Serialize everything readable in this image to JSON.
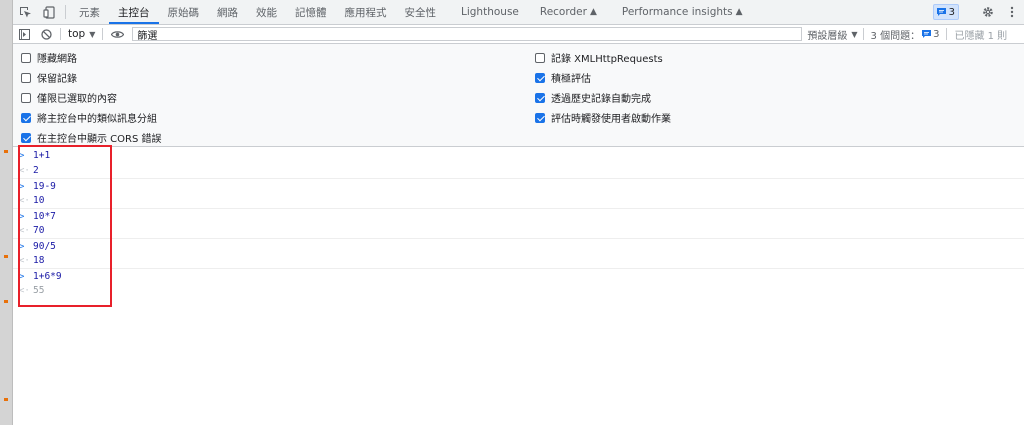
{
  "tabs": {
    "items": [
      {
        "label": "元素"
      },
      {
        "label": "主控台"
      },
      {
        "label": "原始碼"
      },
      {
        "label": "網路"
      },
      {
        "label": "效能"
      },
      {
        "label": "記憶體"
      },
      {
        "label": "應用程式"
      },
      {
        "label": "安全性"
      },
      {
        "label": "Lighthouse"
      },
      {
        "label": "Recorder"
      },
      {
        "label": "Performance insights"
      }
    ],
    "active_index": 1,
    "message_count": "3"
  },
  "toolbar": {
    "context": "top",
    "filter_placeholder": "篩選",
    "levels_label": "預設層級",
    "issues_label": "3 個問題：",
    "issues_count": "3",
    "hidden_label": "已隱藏 1 則"
  },
  "settings": {
    "left": [
      {
        "label": "隱藏網路",
        "checked": false
      },
      {
        "label": "保留記錄",
        "checked": false
      },
      {
        "label": "僅限已選取的內容",
        "checked": false
      },
      {
        "label": "將主控台中的類似訊息分組",
        "checked": true
      },
      {
        "label": "在主控台中顯示 CORS 錯誤",
        "checked": true
      }
    ],
    "right": [
      {
        "label": "記錄 XMLHttpRequests",
        "checked": false
      },
      {
        "label": "積極評估",
        "checked": true
      },
      {
        "label": "透過歷史記錄自動完成",
        "checked": true
      },
      {
        "label": "評估時觸發使用者啟動作業",
        "checked": true
      }
    ]
  },
  "console": {
    "lines": [
      {
        "kind": "in",
        "text": "1+1"
      },
      {
        "kind": "out",
        "text": "2"
      },
      {
        "kind": "in",
        "text": "19-9"
      },
      {
        "kind": "out",
        "text": "10"
      },
      {
        "kind": "in",
        "text": "10*7"
      },
      {
        "kind": "out",
        "text": "70"
      },
      {
        "kind": "in",
        "text": "90/5"
      },
      {
        "kind": "out",
        "text": "18"
      },
      {
        "kind": "in",
        "text": "1+6*9"
      },
      {
        "kind": "preview",
        "text": "55"
      }
    ]
  },
  "colors": {
    "accent": "#1a73e8",
    "highlight_box": "#e8202a"
  }
}
